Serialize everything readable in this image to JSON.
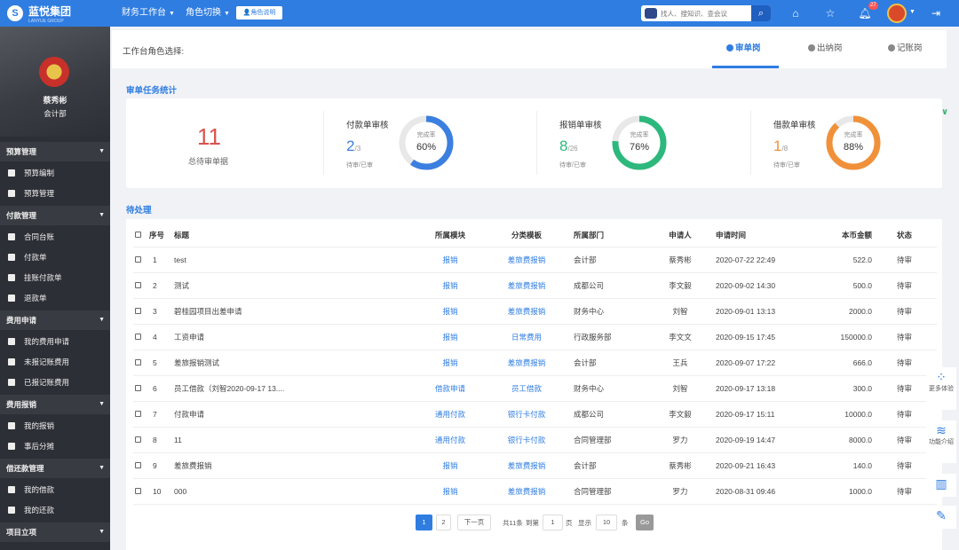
{
  "app": {
    "brand": "蓝悦集团",
    "brand_sub": "LANYUE GROUP"
  },
  "topbar": {
    "workspace": "财务工作台",
    "role_switch": "角色切换",
    "role_desc": "角色说明",
    "search_placeholder": "找人、搜知识、查会议",
    "notification_count": "27"
  },
  "user": {
    "name": "蔡秀彬",
    "dept": "会计部"
  },
  "sidebar": {
    "groups": [
      {
        "label": "预算管理",
        "items": [
          "预算编制",
          "预算管理"
        ]
      },
      {
        "label": "付款管理",
        "items": [
          "合同台账",
          "付款单",
          "挂账付款单",
          "退款单"
        ]
      },
      {
        "label": "费用申请",
        "items": [
          "我的费用申请",
          "未报记账费用",
          "已报记账费用"
        ]
      },
      {
        "label": "费用报销",
        "items": [
          "我的报销",
          "事后分摊"
        ]
      },
      {
        "label": "借还款管理",
        "items": [
          "我的借款",
          "我的还款"
        ]
      },
      {
        "label": "项目立项",
        "items": []
      }
    ]
  },
  "roles": {
    "label": "工作台角色选择:",
    "tabs": [
      "审单岗",
      "出纳岗",
      "记账岗"
    ],
    "active": 0
  },
  "stats": {
    "title": "审单任务统计",
    "total_value": "11",
    "total_label": "总待审单据",
    "pending_done": "待审/已审",
    "rate_label": "完成率",
    "cards": [
      {
        "title": "付款单审核",
        "pending": "2",
        "total": "/3",
        "rate": "60%",
        "percent": 60,
        "color": "#3b7fe0"
      },
      {
        "title": "报销单审核",
        "pending": "8",
        "total": "/26",
        "rate": "76%",
        "percent": 76,
        "color": "#2db87d"
      },
      {
        "title": "借款单审核",
        "pending": "1",
        "total": "/8",
        "rate": "88%",
        "percent": 88,
        "color": "#f0913a"
      }
    ]
  },
  "pending": {
    "title": "待处理",
    "columns": [
      "序号",
      "标题",
      "所属模块",
      "分类模板",
      "所属部门",
      "申请人",
      "申请时间",
      "本币金额",
      "状态"
    ],
    "rows": [
      [
        "1",
        "test",
        "报销",
        "差旅费报销",
        "会计部",
        "蔡秀彬",
        "2020-07-22 22:49",
        "522.0",
        "待审"
      ],
      [
        "2",
        "测试",
        "报销",
        "差旅费报销",
        "成都公司",
        "李文毅",
        "2020-09-02 14:30",
        "500.0",
        "待审"
      ],
      [
        "3",
        "碧桂园项目出差申请",
        "报销",
        "差旅费报销",
        "财务中心",
        "刘智",
        "2020-09-01 13:13",
        "2000.0",
        "待审"
      ],
      [
        "4",
        "工资申请",
        "报销",
        "日常费用",
        "行政服务部",
        "李文文",
        "2020-09-15 17:45",
        "150000.0",
        "待审"
      ],
      [
        "5",
        "差旅报销测试",
        "报销",
        "差旅费报销",
        "会计部",
        "王兵",
        "2020-09-07 17:22",
        "666.0",
        "待审"
      ],
      [
        "6",
        "员工借款（刘智2020-09-17 13....",
        "借款申请",
        "员工借款",
        "财务中心",
        "刘智",
        "2020-09-17 13:18",
        "300.0",
        "待审"
      ],
      [
        "7",
        "付款申请",
        "通用付款",
        "银行卡付款",
        "成都公司",
        "李文毅",
        "2020-09-17 15:11",
        "10000.0",
        "待审"
      ],
      [
        "8",
        "11",
        "通用付款",
        "银行卡付款",
        "合同管理部",
        "罗力",
        "2020-09-19 14:47",
        "8000.0",
        "待审"
      ],
      [
        "9",
        "差旅费报销",
        "报销",
        "差旅费报销",
        "会计部",
        "蔡秀彬",
        "2020-09-21 16:43",
        "140.0",
        "待审"
      ],
      [
        "10",
        "000",
        "报销",
        "差旅费报销",
        "合同管理部",
        "罗力",
        "2020-08-31 09:46",
        "1000.0",
        "待审"
      ]
    ]
  },
  "pagination": {
    "pages": [
      "1",
      "2"
    ],
    "next": "下一页",
    "total": "共11条",
    "goto": "到第",
    "page_value": "1",
    "page_unit": "页",
    "show": "显示",
    "size_value": "10",
    "size_unit": "条",
    "go": "Go"
  },
  "float": {
    "more": "更多体验",
    "intro": "功能介绍"
  },
  "icons": [
    "search-icon",
    "home-icon",
    "star-icon",
    "bell-icon",
    "logout-icon",
    "chevron-down-icon",
    "grid-icon",
    "layers-icon",
    "chart-icon",
    "edit-icon",
    "user-icon"
  ]
}
